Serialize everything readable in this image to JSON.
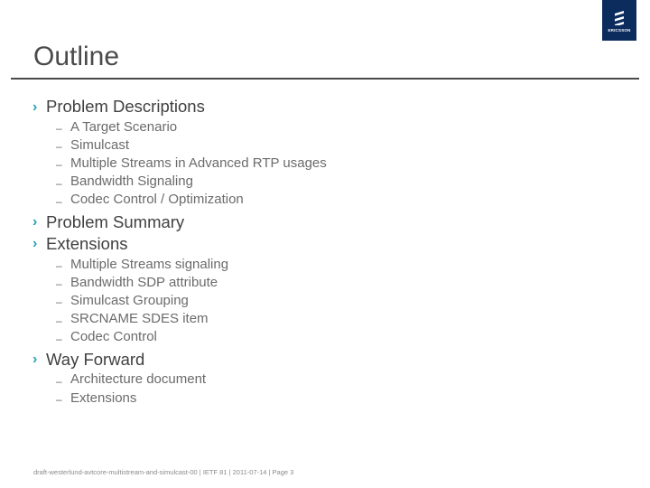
{
  "brand": {
    "name": "ERICSSON",
    "color": "#0d2c5e",
    "accent": "#23a2b8"
  },
  "slide": {
    "title": "Outline",
    "sections": [
      {
        "label": "Problem Descriptions",
        "items": [
          "A Target Scenario",
          "Simulcast",
          "Multiple Streams in Advanced RTP usages",
          "Bandwidth Signaling",
          "Codec Control / Optimization"
        ]
      },
      {
        "label": "Problem Summary",
        "items": []
      },
      {
        "label": "Extensions",
        "items": [
          "Multiple Streams signaling",
          "Bandwidth SDP attribute",
          "Simulcast Grouping",
          "SRCNAME SDES item",
          "Codec Control"
        ]
      },
      {
        "label": "Way Forward",
        "items": [
          "Architecture document",
          "Extensions"
        ]
      }
    ],
    "bullet_glyph": "›",
    "sub_bullet_glyph": "–"
  },
  "footer": {
    "text": "draft-westerlund-avtcore-multistream-and-simulcast-00 | IETF 81 | 2011-07-14 | Page 3"
  }
}
